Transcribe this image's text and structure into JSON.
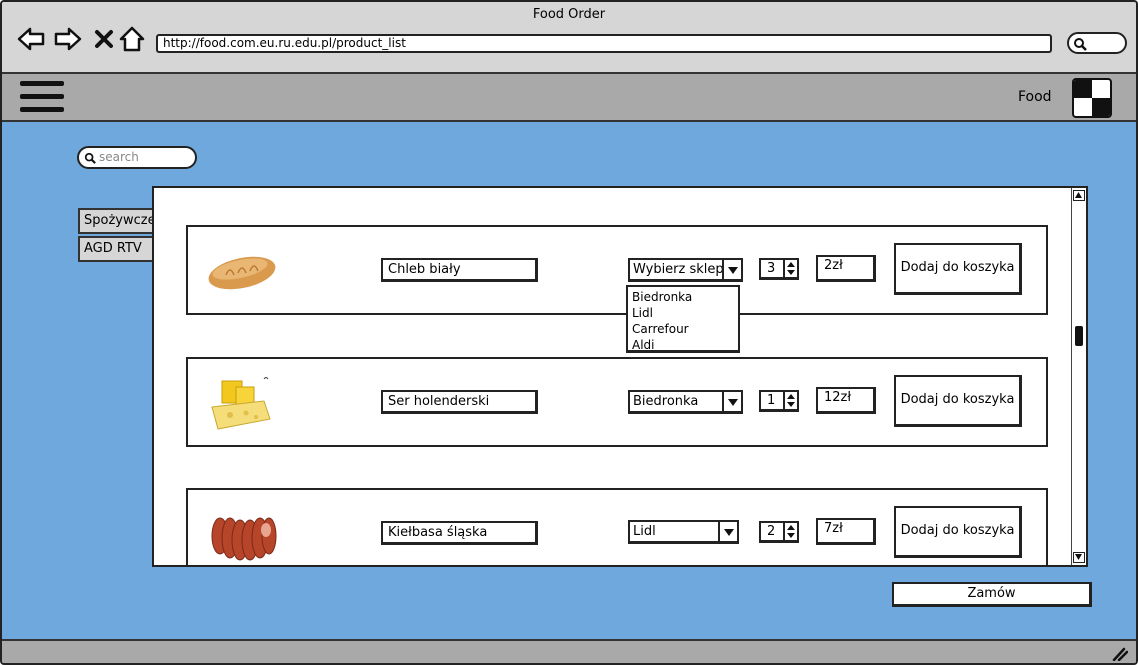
{
  "window": {
    "title": "Food Order"
  },
  "browser": {
    "url": "http://food.com.eu.ru.edu.pl/product_list"
  },
  "toolbar": {
    "brand": "Food"
  },
  "search": {
    "placeholder": "search"
  },
  "categories": [
    {
      "label": "Spożywcze"
    },
    {
      "label": "AGD RTV"
    }
  ],
  "products": [
    {
      "name": "Chleb biały",
      "shop": "Wybierz sklep",
      "quantity": "3",
      "price": "2zł",
      "add_label": "Dodaj do koszyka",
      "image": "bread-image"
    },
    {
      "name": "Ser holenderski",
      "shop": "Biedronka",
      "quantity": "1",
      "price": "12zł",
      "add_label": "Dodaj do koszyka",
      "image": "cheese-image"
    },
    {
      "name": "Kiełbasa śląska",
      "shop": "Lidl",
      "quantity": "2",
      "price": "7zł",
      "add_label": "Dodaj do koszyka",
      "image": "sausage-image"
    }
  ],
  "shop_dropdown": {
    "options": [
      "Biedronka",
      "Lidl",
      "Carrefour",
      "Aldi"
    ]
  },
  "order_button": {
    "label": "Zamów"
  },
  "colors": {
    "content_bg": "#6fa8dc",
    "chrome": "#d6d6d6",
    "toolbar": "#a9a9a9"
  }
}
